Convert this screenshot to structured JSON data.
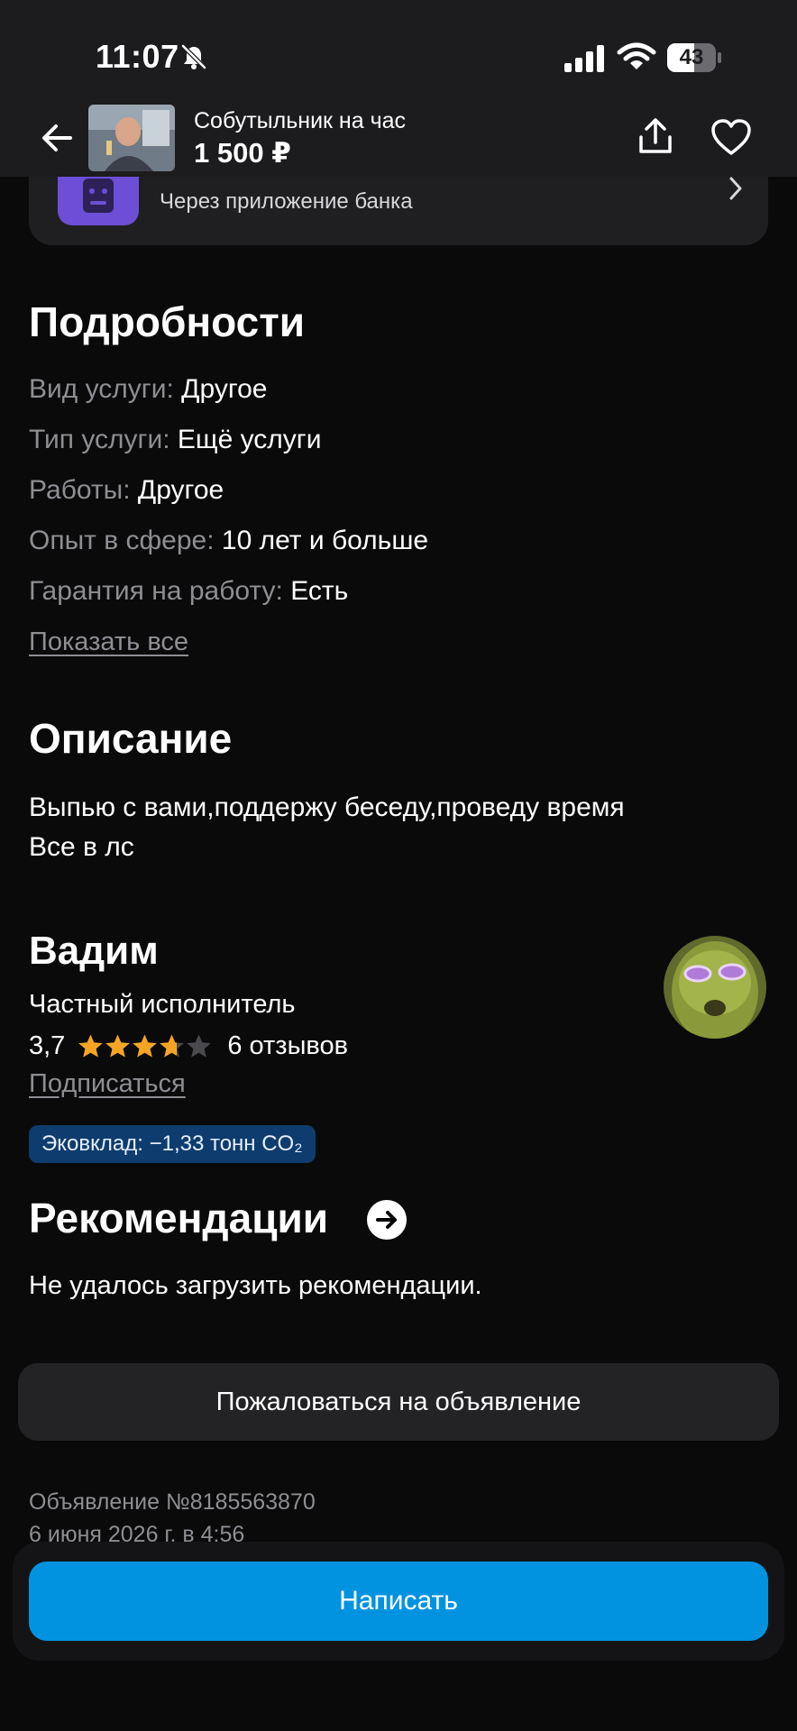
{
  "status_bar": {
    "time": "11:07",
    "battery": "43",
    "icons": [
      "bell-slash-icon",
      "cellular-signal-icon",
      "wifi-icon",
      "battery-icon"
    ]
  },
  "header": {
    "title": "Собутыльник на час",
    "price": "1 500 ₽",
    "icons": [
      "arrow-left-icon",
      "share-icon",
      "heart-icon"
    ]
  },
  "payment_card": {
    "subtitle": "Через приложение банка"
  },
  "details": {
    "title": "Подробности",
    "rows": [
      {
        "key": "Вид услуги:",
        "value": "Другое"
      },
      {
        "key": "Тип услуги:",
        "value": "Ещё услуги"
      },
      {
        "key": "Работы:",
        "value": "Другое"
      },
      {
        "key": "Опыт в сфере:",
        "value": "10 лет и больше"
      },
      {
        "key": "Гарантия на работу:",
        "value": "Есть"
      }
    ],
    "show_all": "Показать все"
  },
  "description": {
    "title": "Описание",
    "lines": [
      "Выпью с вами,поддержу беседу,проведу время",
      "Все в лс"
    ]
  },
  "seller": {
    "name": "Вадим",
    "type": "Частный исполнитель",
    "rating": "3,7",
    "rating_value": 3.7,
    "reviews": "6 отзывов",
    "subscribe": "Подписаться",
    "eco": "Эковклад: −1,33 тонн CO₂"
  },
  "recommendations": {
    "title": "Рекомендации",
    "note": "Не удалось загрузить рекомендации."
  },
  "report_button": "Пожаловаться на объявление",
  "ad_info": {
    "number": "Объявление №8185563870",
    "date": "6 июня 2026 г. в 4:56"
  },
  "write_button": "Написать",
  "colors": {
    "accent": "#0193e0",
    "star": "#f5a524",
    "eco_bg": "#0e3c6e",
    "background": "#0a0a0b"
  }
}
